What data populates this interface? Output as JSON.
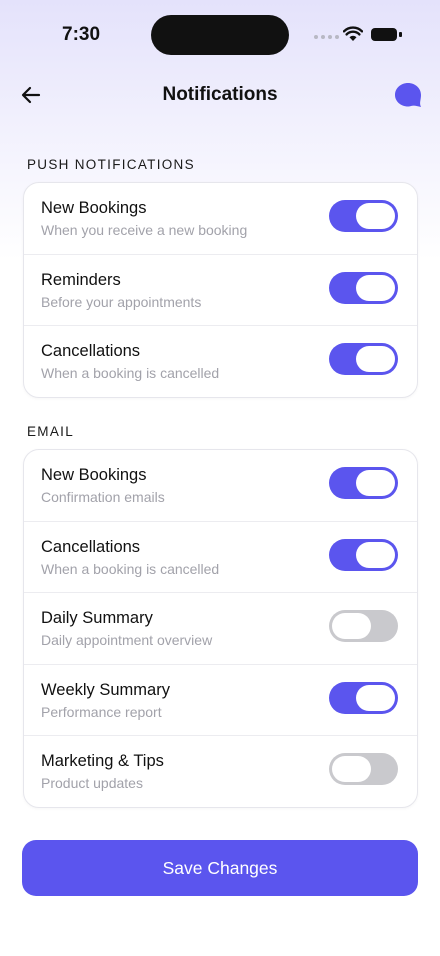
{
  "status_bar": {
    "time": "7:30"
  },
  "header": {
    "title": "Notifications"
  },
  "sections": [
    {
      "label": "PUSH NOTIFICATIONS",
      "items": [
        {
          "title": "New Bookings",
          "subtitle": "When you receive a new booking",
          "enabled": true
        },
        {
          "title": "Reminders",
          "subtitle": "Before your appointments",
          "enabled": true
        },
        {
          "title": "Cancellations",
          "subtitle": "When a booking is cancelled",
          "enabled": true
        }
      ]
    },
    {
      "label": "EMAIL",
      "items": [
        {
          "title": "New Bookings",
          "subtitle": "Confirmation emails",
          "enabled": true
        },
        {
          "title": "Cancellations",
          "subtitle": "When a booking is cancelled",
          "enabled": true
        },
        {
          "title": "Daily Summary",
          "subtitle": "Daily appointment overview",
          "enabled": false
        },
        {
          "title": "Weekly Summary",
          "subtitle": "Performance report",
          "enabled": true
        },
        {
          "title": "Marketing & Tips",
          "subtitle": "Product updates",
          "enabled": false
        }
      ]
    }
  ],
  "save_button": {
    "label": "Save Changes"
  },
  "colors": {
    "accent": "#5b55ee",
    "toggle_off": "#c9c9cd"
  }
}
